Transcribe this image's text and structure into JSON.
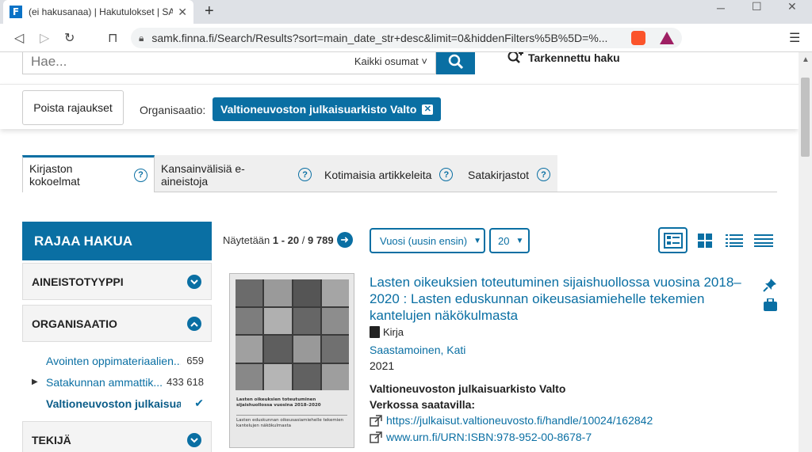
{
  "browser": {
    "tab_title": "(ei hakusanaa) | Hakutulokset | SA",
    "favicon_letter": "F",
    "url": "samk.finna.fi/Search/Results?sort=main_date_str+desc&limit=0&hiddenFilters%5B%5D=%..."
  },
  "search": {
    "placeholder": "Hae...",
    "type": "Kaikki osumat",
    "advanced": "Tarkennettu haku"
  },
  "filters": {
    "remove_label": "Poista rajaukset",
    "org_label": "Organisaatio:",
    "active_org": "Valtioneuvoston julkaisuarkisto Valto"
  },
  "tabs": [
    {
      "label": "Kirjaston kokoelmat",
      "active": true
    },
    {
      "label": "Kansainvälisiä e-aineistoja",
      "active": false
    },
    {
      "label": "Kotimaisia artikkeleita",
      "active": false
    },
    {
      "label": "Satakirjastot",
      "active": false
    }
  ],
  "sidebar": {
    "title": "RAJAA HAKUA",
    "facets": [
      {
        "label": "AINEISTOTYYPPI",
        "expanded": false
      },
      {
        "label": "ORGANISAATIO",
        "expanded": true
      },
      {
        "label": "TEKIJÄ",
        "expanded": false
      }
    ],
    "org_items": [
      {
        "label": "Avointen oppimateriaalien...",
        "count": "659"
      },
      {
        "label": "Satakunnan ammattik...",
        "count": "433 618"
      },
      {
        "label": "Valtioneuvoston julkaisua...",
        "count": ""
      }
    ]
  },
  "results": {
    "showing_prefix": "Näytetään",
    "range": "1 - 20",
    "separator": "/",
    "total": "9 789",
    "sort": "Vuosi (uusin ensin)",
    "limit": "20"
  },
  "record": {
    "title": "Lasten oikeuksien toteutuminen sijaishuollossa vuosina 2018–2020 : Lasten eduskunnan oikeusasiamiehelle tekemien kantelujen näkökulmasta",
    "format": "Kirja",
    "author": "Saastamoinen, Kati",
    "year": "2021",
    "organisation": "Valtioneuvoston julkaisuarkisto Valto",
    "online_label": "Verkossa saatavilla:",
    "links": [
      "https://julkaisut.valtioneuvosto.fi/handle/10024/162842",
      "www.urn.fi/URN:ISBN:978-952-00-8678-7"
    ],
    "cover_title": "Lasten oikeuksien toteutuminen sijaishuollossa vuosina 2018–2020",
    "cover_subtitle": "Lasten eduskunnan oikeusasiamiehelle tekemien kantelujen näkökulmasta"
  },
  "colors": {
    "accent": "#0a6fa3"
  }
}
